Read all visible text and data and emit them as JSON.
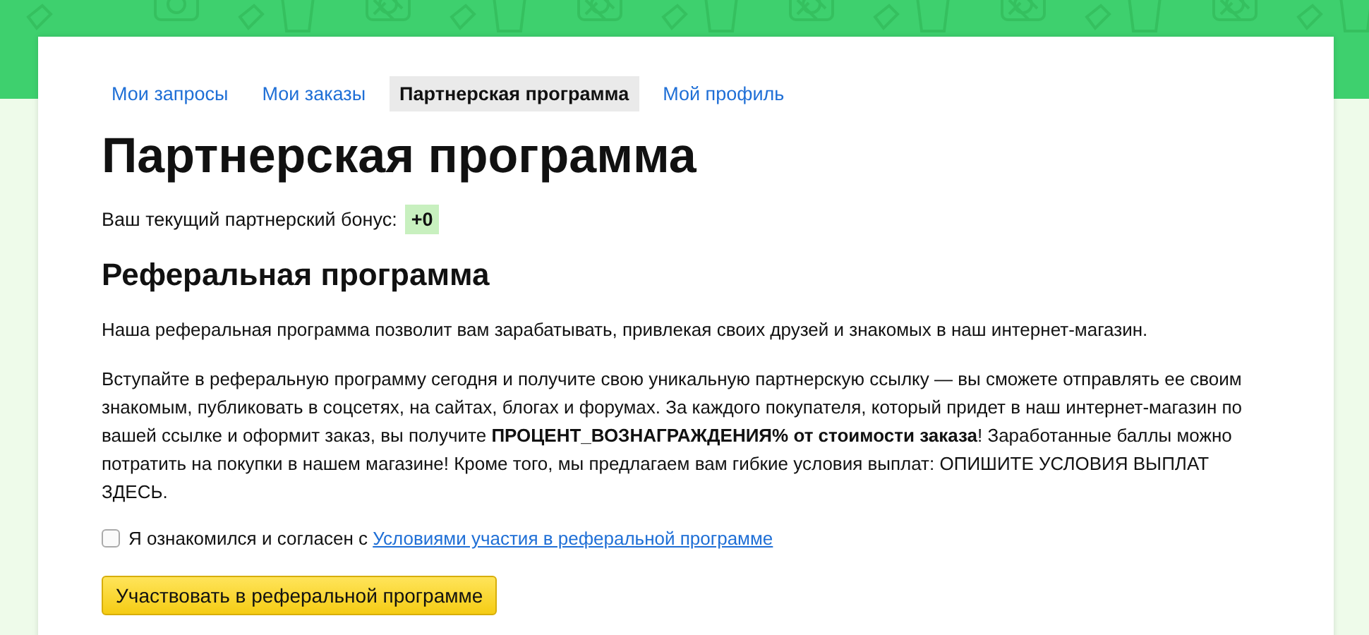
{
  "tabs": [
    {
      "label": "Мои запросы",
      "selected": false
    },
    {
      "label": "Мои заказы",
      "selected": false
    },
    {
      "label": "Партнерская программа",
      "selected": true
    },
    {
      "label": "Мой профиль",
      "selected": false
    }
  ],
  "title": "Партнерская программа",
  "bonus": {
    "label": "Ваш текущий партнерский бонус:",
    "value": "+0"
  },
  "section_title": "Реферальная программа",
  "paragraphs": [
    "Наша реферальная программа позволит вам зарабатывать, привлекая своих друзей и знакомых в наш интернет-магазин.",
    "Вступайте в реферальную программу сегодня и получите свою уникальную партнерскую ссылку — вы сможете отправлять ее своим знакомым, публиковать в соцсетях, на сайтах, блогах и форумах. За каждого покупателя, который придет в наш интернет-магазин по вашей ссылке и оформит заказ, вы получите **ПРОЦЕНТ_ВОЗНАГРАЖДЕНИЯ% от стоимости заказа**! Заработанные баллы можно потратить на покупки в нашем магазине! Кроме того, мы предлагаем вам гибкие условия выплат: ОПИШИТЕ УСЛОВИЯ ВЫПЛАТ ЗДЕСЬ."
  ],
  "agreement": {
    "checked": false,
    "text": "Я ознакомился и согласен с",
    "link": "Условиями участия в реферальной программе"
  },
  "button": "Участвовать в реферальной программе"
}
